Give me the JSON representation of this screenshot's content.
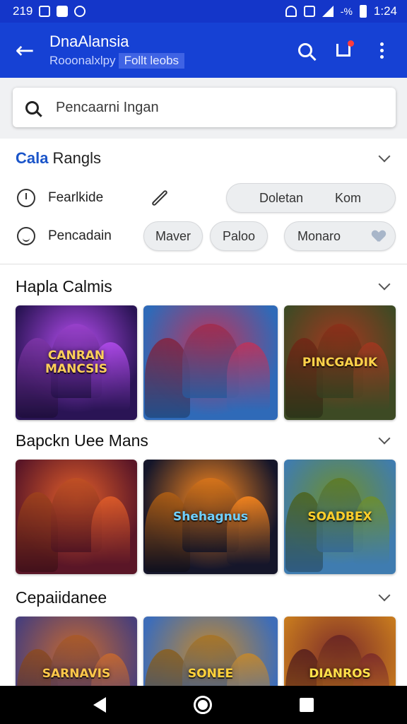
{
  "status_bar": {
    "time_left": "219",
    "time_right": "1:24",
    "battery": "-%"
  },
  "app_bar": {
    "title": "DnaAlansia",
    "subtitle": "Rooonalxlpy",
    "chip": "Follt leobs",
    "back_icon": "arrow-left-icon",
    "actions": [
      "search-icon",
      "cart-icon",
      "more-vert-icon"
    ]
  },
  "search": {
    "placeholder": "Pencaarni Ingan"
  },
  "filters": {
    "brand": "Cala",
    "title": "Rangls",
    "row1": {
      "label": "Fearlkide",
      "pill": {
        "left": "Doletan",
        "right": "Kom"
      }
    },
    "row2": {
      "label": "Pencadain",
      "pills": [
        "Maver",
        "Paloo",
        "Monaro"
      ]
    }
  },
  "sections": [
    {
      "title": "Hapla Calmis",
      "tiles": [
        {
          "label": "CANRAN MANCSIS",
          "bg": "#2a1455",
          "accent": "#b54df0",
          "text": "#ffcf5a"
        },
        {
          "label": "",
          "bg": "#2f6ab8",
          "accent": "#c0335a",
          "text": "#ffffff"
        },
        {
          "label": "PINCGADIK",
          "bg": "#3d4a24",
          "accent": "#a4371f",
          "text": "#ffd24a"
        }
      ]
    },
    {
      "title": "Bapckn Uee Mans",
      "tiles": [
        {
          "label": "",
          "bg": "#5a1627",
          "accent": "#e35f2a",
          "text": "#ffffff"
        },
        {
          "label": "Shehagnus",
          "bg": "#15162a",
          "accent": "#ff8a1e",
          "text": "#6fd0ff"
        },
        {
          "label": "SOADBEX",
          "bg": "#3f7cb0",
          "accent": "#6f8f2a",
          "text": "#ffcf2a"
        }
      ]
    },
    {
      "title": "Cepaiidanee",
      "tiles": [
        {
          "label": "SARNAVIS",
          "bg": "#4a3f7a",
          "accent": "#c96a2e",
          "text": "#ffc84a"
        },
        {
          "label": "SONEE",
          "bg": "#3e6db8",
          "accent": "#c7892a",
          "text": "#ffd23a"
        },
        {
          "label": "DIANROS",
          "bg": "#c77a1e",
          "accent": "#7a2a2a",
          "text": "#ffe04a"
        }
      ]
    }
  ],
  "colors": {
    "primary": "#1641d4",
    "status_bar": "#1436c9",
    "pill_bg": "#eceef0"
  },
  "nav_bar": [
    "nav-back-icon",
    "nav-home-icon",
    "nav-recents-icon"
  ]
}
